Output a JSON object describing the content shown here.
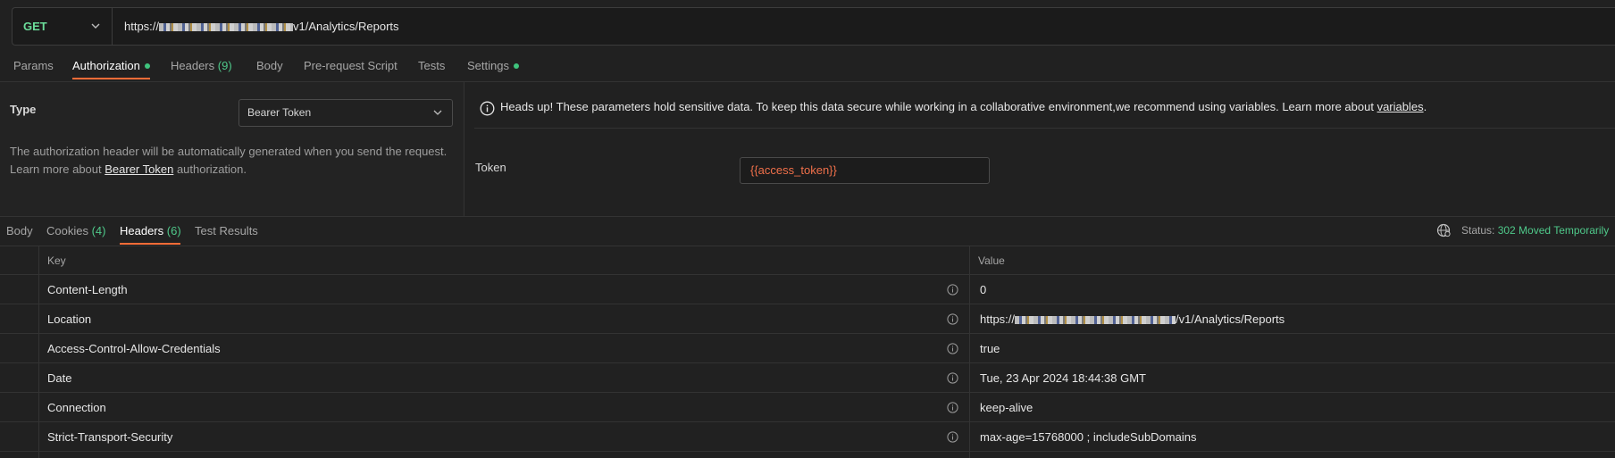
{
  "request": {
    "method": "GET",
    "url_prefix": "https://",
    "url_suffix": "v1/Analytics/Reports"
  },
  "request_tabs": [
    {
      "label": "Params"
    },
    {
      "label": "Authorization"
    },
    {
      "label": "Headers",
      "count": "(9)"
    },
    {
      "label": "Body"
    },
    {
      "label": "Pre-request Script"
    },
    {
      "label": "Tests"
    },
    {
      "label": "Settings"
    }
  ],
  "auth": {
    "type_label": "Type",
    "type_value": "Bearer Token",
    "desc_line1": "The authorization header will be automatically generated when you send the request.",
    "desc_line2_prefix": "Learn more about ",
    "desc_link": "Bearer Token",
    "desc_line2_suffix": " authorization.",
    "notice_text": "Heads up! These parameters hold sensitive data. To keep this data secure while working in a collaborative environment,we recommend using variables. Learn more about ",
    "notice_link": "variables",
    "notice_end": ".",
    "token_label": "Token",
    "token_value": "{{access_token}}"
  },
  "response_tabs": [
    {
      "label": "Body"
    },
    {
      "label": "Cookies",
      "count": "(4)"
    },
    {
      "label": "Headers",
      "count": "(6)"
    },
    {
      "label": "Test Results"
    }
  ],
  "status": {
    "label": "Status:",
    "value": "302 Moved Temporarily"
  },
  "headers_table": {
    "col_key": "Key",
    "col_value": "Value",
    "rows": [
      {
        "key": "Content-Length",
        "value": "0"
      },
      {
        "key": "Location",
        "value_prefix": "https://",
        "value_suffix": "/v1/Analytics/Reports"
      },
      {
        "key": "Access-Control-Allow-Credentials",
        "value": "true"
      },
      {
        "key": "Date",
        "value": "Tue, 23 Apr 2024 18:44:38 GMT"
      },
      {
        "key": "Connection",
        "value": "keep-alive"
      },
      {
        "key": "Strict-Transport-Security",
        "value": "max-age=15768000 ; includeSubDomains"
      }
    ]
  },
  "colors": {
    "accent": "#ff6c37",
    "method": "#6bdd9a",
    "count": "#4fc98a",
    "token": "#f0704a"
  }
}
